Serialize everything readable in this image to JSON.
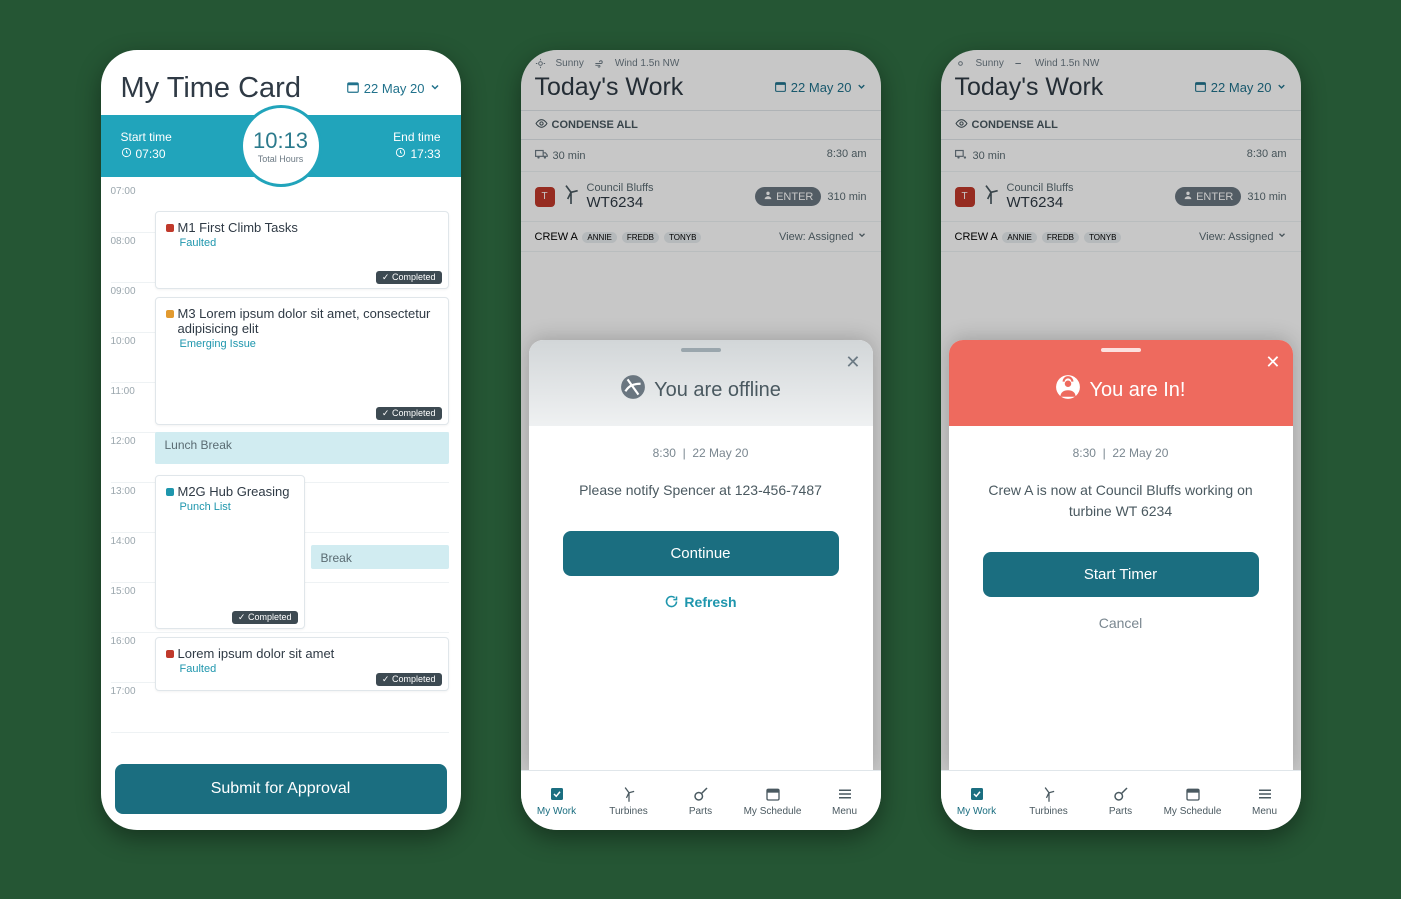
{
  "screen1": {
    "title": "My Time Card",
    "date": "22 May 20",
    "start_label": "Start time",
    "start_time": "07:30",
    "end_label": "End time",
    "end_time": "17:33",
    "total_hours": "10:13",
    "total_hours_label": "Total Hours",
    "hours": [
      "07:00",
      "08:00",
      "09:00",
      "10:00",
      "11:00",
      "12:00",
      "13:00",
      "14:00",
      "15:00",
      "16:00",
      "17:00"
    ],
    "task1_title": "M1 First Climb Tasks",
    "task1_sub": "Faulted",
    "task2_title": "M3 Lorem ipsum dolor sit amet, consectetur adipisicing elit",
    "task2_sub": "Emerging Issue",
    "task3_title": "M2G Hub Greasing",
    "task3_sub": "Punch List",
    "task4_title": "Lorem ipsum dolor sit amet",
    "task4_sub": "Faulted",
    "lunch": "Lunch Break",
    "break": "Break",
    "completed": "✓ Completed",
    "submit": "Submit for Approval"
  },
  "tw": {
    "weather1": "Sunny",
    "weather2": "Wind 1.5n NW",
    "title": "Today's Work",
    "date": "22 May 20",
    "condense": "CONDENSE ALL",
    "drive_time": "30 min",
    "arrive": "8:30 am",
    "site_name": "Council Bluffs",
    "site_code": "WT6234",
    "enter": "ENTER",
    "site_mins": "310 min",
    "crew": "CREW A",
    "crew_m1": "ANNIE",
    "crew_m2": "FREDB",
    "crew_m3": "TONYB",
    "view": "View: Assigned"
  },
  "sheet_offline": {
    "title": "You are offline",
    "time": "8:30",
    "date": "22 May 20",
    "msg": "Please notify Spencer at 123-456-7487",
    "primary": "Continue",
    "secondary": "Refresh"
  },
  "sheet_in": {
    "title": "You are In!",
    "time": "8:30",
    "date": "22 May 20",
    "msg": "Crew A is now at Council Bluffs working on turbine WT 6234",
    "primary": "Start Timer",
    "secondary": "Cancel"
  },
  "nav": {
    "mywork": "My Work",
    "turbines": "Turbines",
    "parts": "Parts",
    "schedule": "My Schedule",
    "menu": "Menu"
  }
}
